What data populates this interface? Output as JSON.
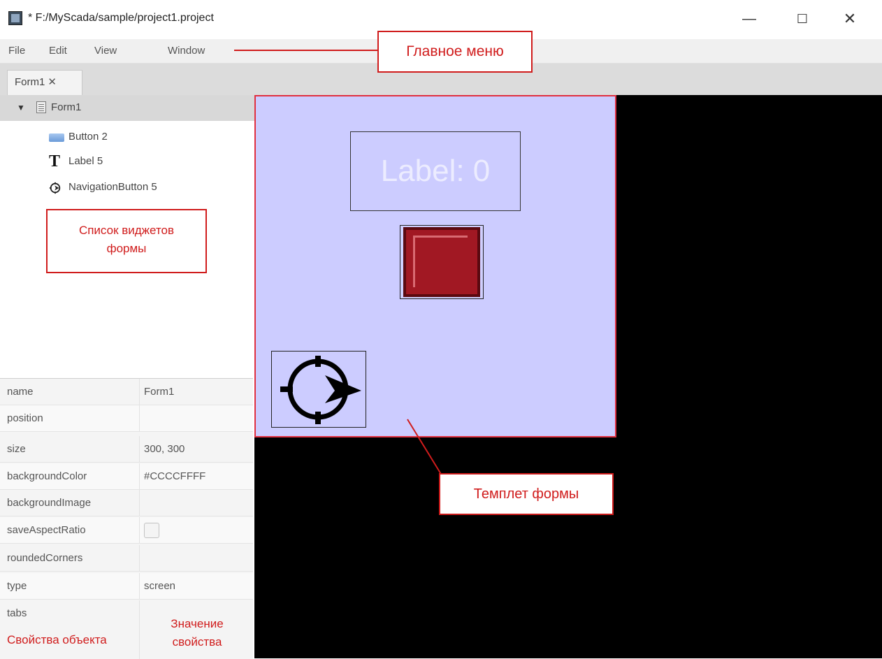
{
  "window": {
    "title": "* F:/MyScada/sample/project1.project",
    "minimize_glyph": "—",
    "maximize_glyph": "☐",
    "close_glyph": "✕"
  },
  "menu": {
    "file": "File",
    "edit": "Edit",
    "view": "View",
    "window": "Window"
  },
  "tabs": [
    {
      "label": "Form1",
      "close_glyph": "✕"
    }
  ],
  "tree": {
    "expand_glyph": "▼",
    "root": "Form1",
    "items": [
      {
        "label": "Button 2",
        "icon": "button-icon"
      },
      {
        "label": "Label 5",
        "icon": "label-icon",
        "icon_glyph": "T"
      },
      {
        "label": "NavigationButton 5",
        "icon": "navigation-icon"
      }
    ]
  },
  "properties": [
    {
      "name": "name",
      "value": "Form1"
    },
    {
      "name": "position",
      "value": ""
    },
    {
      "name": "size",
      "value": "300, 300"
    },
    {
      "name": "backgroundColor",
      "value": "#CCCCFFFF"
    },
    {
      "name": "backgroundImage",
      "value": ""
    },
    {
      "name": "saveAspectRatio",
      "value": "",
      "checkbox": true,
      "checked": false
    },
    {
      "name": "roundedCorners",
      "value": ""
    },
    {
      "name": "type",
      "value": "screen"
    },
    {
      "name": "tabs",
      "value": ""
    }
  ],
  "form": {
    "label_text": "Label: 0",
    "background": "#ccccff",
    "button_color": "#a11823"
  },
  "annotations": {
    "main_menu": "Главное меню",
    "widget_list_line1": "Список виджетов",
    "widget_list_line2": "формы",
    "form_template": "Темплет формы",
    "object_properties": "Свойства объекта",
    "property_value_line1": "Значение",
    "property_value_line2": "свойства",
    "color": "#d01c1c"
  }
}
